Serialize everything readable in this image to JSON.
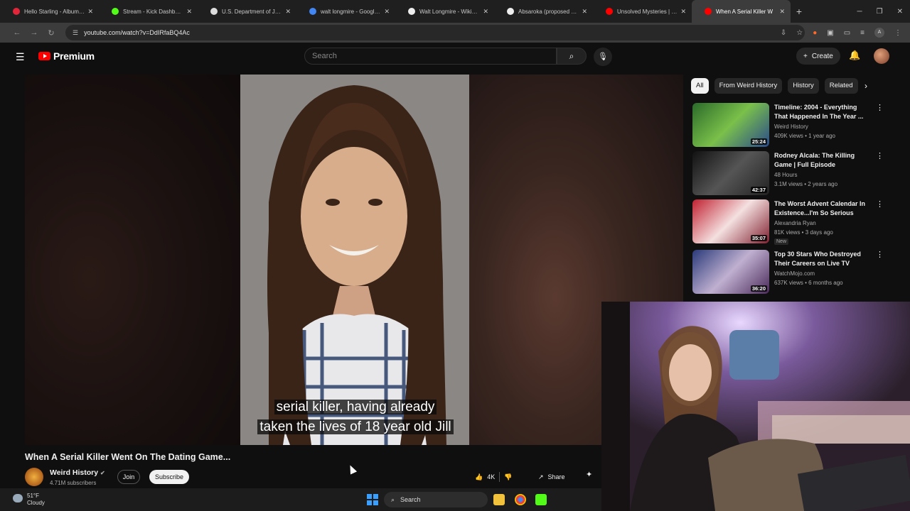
{
  "browser": {
    "tabs": [
      {
        "title": "Hello Starling - Album by",
        "fav_color": "#e3253a"
      },
      {
        "title": "Stream - Kick Dashboard",
        "fav_color": "#53fc18"
      },
      {
        "title": "U.S. Department of Justice",
        "fav_color": "#dddddd"
      },
      {
        "title": "walt longmire - Google Se",
        "fav_color": "#4285f4"
      },
      {
        "title": "Walt Longmire - Wikipedia",
        "fav_color": "#eeeeee"
      },
      {
        "title": "Absaroka (proposed state",
        "fav_color": "#eeeeee"
      },
      {
        "title": "Unsolved Mysteries | Robe",
        "fav_color": "#ff0000"
      },
      {
        "title": "When A Serial Killer W",
        "fav_color": "#ff0000"
      }
    ],
    "tab_close": "✕",
    "new_tab": "+",
    "url": "youtube.com/watch?v=DdIRfaBQ4Ac"
  },
  "youtube": {
    "brand": "Premium",
    "search_placeholder": "Search",
    "create_label": "Create",
    "video": {
      "title": "When A Serial Killer Went On The Dating Game...",
      "caption_line1": "serial killer, having already",
      "caption_line2": "taken the lives of 18 year old Jill"
    },
    "channel": {
      "name": "Weird History",
      "subscribers": "4.71M subscribers",
      "join_label": "Join",
      "subscribe_label": "Subscribe"
    },
    "actions": {
      "likes": "4K",
      "share_label": "Share"
    },
    "chips": [
      "All",
      "From Weird History",
      "History",
      "Related"
    ],
    "recommendations": [
      {
        "title": "Timeline: 2004 - Everything That Happened In The Year ...",
        "channel": "Weird History",
        "meta": "409K views • 1 year ago",
        "duration": "25:24",
        "badge": ""
      },
      {
        "title": "Rodney Alcala: The Killing Game | Full Episode",
        "channel": "48 Hours",
        "meta": "3.1M views • 2 years ago",
        "duration": "42:37",
        "badge": ""
      },
      {
        "title": "The Worst Advent Calendar In Existence...I'm So Serious",
        "channel": "Alexandria Ryan",
        "meta": "81K views • 3 days ago",
        "duration": "35:07",
        "badge": "New"
      },
      {
        "title": "Top 30 Stars Who Destroyed Their Careers on Live TV",
        "channel": "WatchMojo.com",
        "meta": "637K views • 6 months ago",
        "duration": "36:20",
        "badge": ""
      }
    ]
  },
  "taskbar": {
    "temperature": "51°F",
    "weather": "Cloudy",
    "search_label": "Search"
  }
}
